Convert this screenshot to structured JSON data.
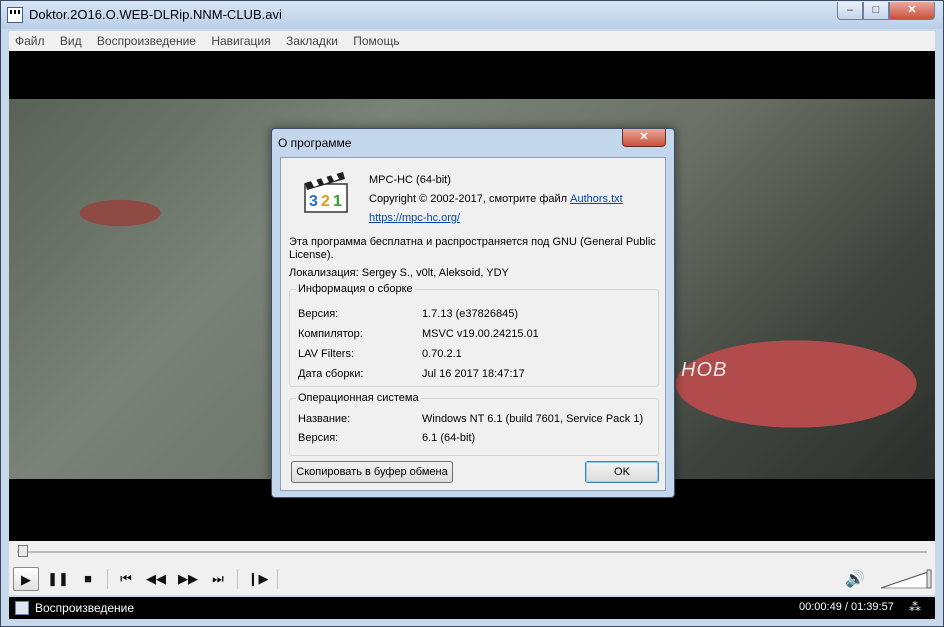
{
  "window": {
    "title": "Doktor.2O16.O.WEB-DLRip.NNM-CLUB.avi",
    "buttons": {
      "minimize": "–",
      "maximize": "□",
      "close": "✕"
    }
  },
  "menu": [
    "Файл",
    "Вид",
    "Воспроизведение",
    "Навигация",
    "Закладки",
    "Помощь"
  ],
  "video": {
    "overlay_text": "НОВ"
  },
  "about_dialog": {
    "title": "О программе",
    "close_glyph": "✕",
    "app_name": "MPC-HC (64-bit)",
    "copyright_prefix": "Copyright © 2002-2017, смотрите файл ",
    "authors_link": "Authors.txt",
    "website": "https://mpc-hc.org/",
    "license_line1": "Эта программа бесплатна и распространяется под GNU (General Public",
    "license_line2": "License).",
    "localization": "Локализация: Sergey S., v0lt, Aleksoid, YDY",
    "build": {
      "title": "Информация о сборке",
      "rows": [
        {
          "label": "Версия:",
          "value": "1.7.13 (e37826845)"
        },
        {
          "label": "Компилятор:",
          "value": "MSVC v19.00.24215.01"
        },
        {
          "label": "LAV Filters:",
          "value": "0.70.2.1"
        },
        {
          "label": "Дата сборки:",
          "value": "Jul 16 2017 18:47:17"
        }
      ]
    },
    "os": {
      "title": "Операционная система",
      "rows": [
        {
          "label": "Название:",
          "value": "Windows NT 6.1 (build 7601, Service Pack 1)"
        },
        {
          "label": "Версия:",
          "value": "6.1 (64-bit)"
        }
      ]
    },
    "copy_button": "Скопировать в буфер обмена",
    "ok_button": "OK"
  },
  "controls": {
    "play": "▶",
    "pause": "❚❚",
    "stop": "■",
    "prev": "⏮",
    "rewind": "◀◀",
    "forward": "▶▶",
    "next": "⏭",
    "frame_step": "❙▶",
    "volume_icon": "🔊"
  },
  "status": {
    "state": "Воспроизведение",
    "time": "00:00:49 / 01:39:57",
    "glyph": "⁂"
  }
}
